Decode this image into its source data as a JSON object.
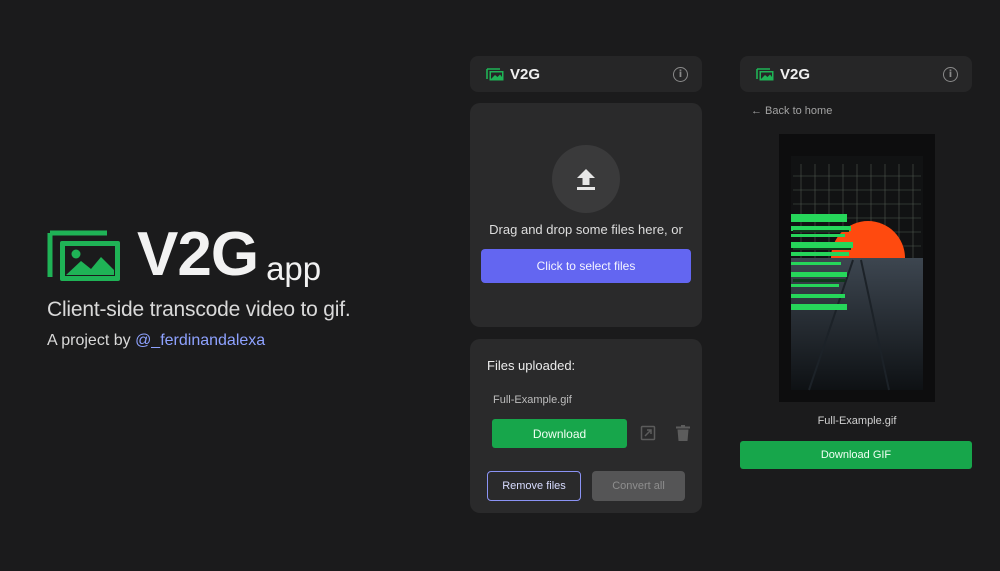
{
  "hero": {
    "title": "V2G",
    "title_suffix": "app",
    "tagline": "Client-side transcode video to gif.",
    "credit_prefix": "A project by",
    "credit_handle": "@_ferdinandalexa",
    "logo_icon": "image-stack-icon"
  },
  "app": {
    "brand": "V2G",
    "brand_icon": "image-stack-icon",
    "info_icon": "info-icon"
  },
  "upload": {
    "icon": "upload-arrow-icon",
    "drag_text": "Drag and drop some files here, or",
    "select_label": "Click to select files"
  },
  "files": {
    "title": "Files uploaded:",
    "items": [
      {
        "name": "Full-Example.gif",
        "download_label": "Download"
      }
    ],
    "remove_label": "Remove files",
    "convert_label": "Convert all"
  },
  "result": {
    "back_label": "← Back to home",
    "file_name": "Full-Example.gif",
    "download_label": "Download GIF"
  },
  "colors": {
    "background": "#1b1b1c",
    "panel": "#262627",
    "card": "#2a2a2b",
    "accent_green": "#17a64b",
    "accent_purple": "#6366f1",
    "link": "#8ea2ff"
  }
}
